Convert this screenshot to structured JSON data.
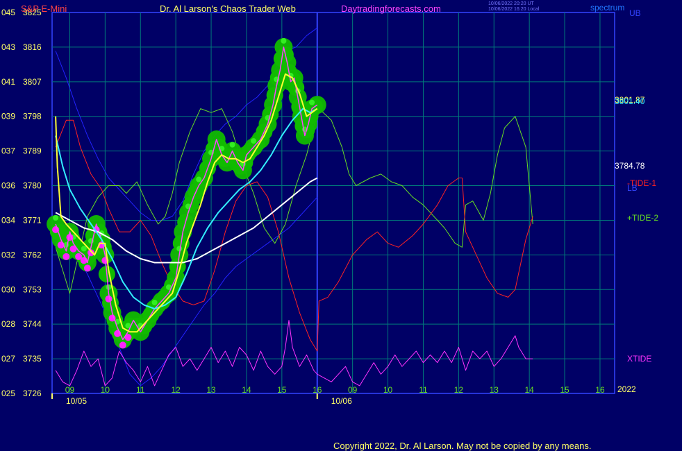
{
  "header": {
    "symbol": "S&P E-Mini",
    "title": "Dr. Al Larson's Chaos Trader Web",
    "site": "Daytradingforecasts.com",
    "stamp_line1": "10/06/2022 20:20 UT",
    "stamp_line2": "10/06/2022 16:20 Local",
    "spectrum": "spectrum",
    "ub": "UB"
  },
  "footer": {
    "copyright": "Copyright 2022, Dr. Al Larson. May not be copied by any means."
  },
  "colors": {
    "background": "#000066",
    "grid": "#007a7a",
    "price_bar": "#ff44ff",
    "band_glow": "#11bb00",
    "band_dot": "#33ee22",
    "magenta_dot": "#ff22ff",
    "ema_fast": "#ffff33",
    "ema_mid": "#33eeff",
    "ema_slow": "#ffffff",
    "bands": "#2222ff",
    "tide1": "#ff2222",
    "tide2": "#66dd22",
    "xtide": "#ff33ff",
    "axis_text": "#ffff66",
    "header_red": "#ff4444",
    "header_site": "#ff44ff"
  },
  "chart_data": {
    "type": "line",
    "title": "S&P E-Mini",
    "y_left_labels": [
      "045",
      "043",
      "041",
      "039",
      "037",
      "036",
      "034",
      "032",
      "030",
      "028",
      "027",
      "025"
    ],
    "y_right_labels": [
      "3825",
      "3816",
      "3807",
      "3798",
      "3789",
      "3780",
      "3771",
      "3762",
      "3753",
      "3744",
      "3735",
      "3726"
    ],
    "ylim": [
      3726,
      3825
    ],
    "x_hour_labels": [
      "09",
      "10",
      "11",
      "12",
      "13",
      "14",
      "15",
      "16",
      "09",
      "10",
      "11",
      "12",
      "13",
      "14",
      "15",
      "16"
    ],
    "x_date_labels": [
      "10/05",
      "10/06"
    ],
    "x_year": "2022",
    "right_value_labels": [
      "3801.87",
      "3801.40",
      "3784.78"
    ],
    "series_labels": {
      "tide1": "-TIDE-1",
      "tide2": "+TIDE-2",
      "xtide": "XTIDE",
      "lb": "LB"
    },
    "price": [
      [
        8.6,
        3770
      ],
      [
        8.75,
        3766
      ],
      [
        8.9,
        3763
      ],
      [
        9.0,
        3768
      ],
      [
        9.1,
        3765
      ],
      [
        9.25,
        3763
      ],
      [
        9.4,
        3762
      ],
      [
        9.5,
        3760
      ],
      [
        9.6,
        3764
      ],
      [
        9.75,
        3770
      ],
      [
        9.9,
        3766
      ],
      [
        10.0,
        3762
      ],
      [
        10.1,
        3752
      ],
      [
        10.2,
        3747
      ],
      [
        10.35,
        3743
      ],
      [
        10.5,
        3740
      ],
      [
        10.65,
        3742
      ],
      [
        10.8,
        3745
      ],
      [
        11.0,
        3742
      ],
      [
        11.2,
        3745
      ],
      [
        11.4,
        3748
      ],
      [
        11.6,
        3750
      ],
      [
        11.8,
        3752
      ],
      [
        12.0,
        3756
      ],
      [
        12.1,
        3762
      ],
      [
        12.2,
        3768
      ],
      [
        12.35,
        3773
      ],
      [
        12.5,
        3777
      ],
      [
        12.65,
        3780
      ],
      [
        12.8,
        3782
      ],
      [
        13.0,
        3787
      ],
      [
        13.15,
        3792
      ],
      [
        13.3,
        3788
      ],
      [
        13.45,
        3786
      ],
      [
        13.6,
        3789
      ],
      [
        13.75,
        3786
      ],
      [
        13.9,
        3784
      ],
      [
        14.0,
        3788
      ],
      [
        14.2,
        3790
      ],
      [
        14.4,
        3792
      ],
      [
        14.6,
        3796
      ],
      [
        14.75,
        3801
      ],
      [
        14.85,
        3806
      ],
      [
        14.95,
        3810
      ],
      [
        15.05,
        3816
      ],
      [
        15.15,
        3812
      ],
      [
        15.25,
        3807
      ],
      [
        15.35,
        3808
      ],
      [
        15.45,
        3803
      ],
      [
        15.55,
        3798
      ],
      [
        15.65,
        3793
      ],
      [
        15.75,
        3796
      ],
      [
        15.85,
        3800
      ],
      [
        16.0,
        3801
      ]
    ],
    "ema_fast": [
      [
        8.6,
        3798
      ],
      [
        8.65,
        3785
      ],
      [
        8.75,
        3772
      ],
      [
        8.9,
        3770
      ],
      [
        9.1,
        3768
      ],
      [
        9.3,
        3766
      ],
      [
        9.5,
        3764
      ],
      [
        9.7,
        3762
      ],
      [
        9.85,
        3765
      ],
      [
        10.0,
        3765
      ],
      [
        10.1,
        3758
      ],
      [
        10.3,
        3749
      ],
      [
        10.5,
        3743
      ],
      [
        10.7,
        3742
      ],
      [
        10.9,
        3742
      ],
      [
        11.1,
        3744
      ],
      [
        11.3,
        3746
      ],
      [
        11.5,
        3748
      ],
      [
        11.7,
        3750
      ],
      [
        11.9,
        3752
      ],
      [
        12.1,
        3758
      ],
      [
        12.3,
        3765
      ],
      [
        12.5,
        3770
      ],
      [
        12.7,
        3775
      ],
      [
        12.9,
        3781
      ],
      [
        13.1,
        3786
      ],
      [
        13.3,
        3788
      ],
      [
        13.5,
        3787
      ],
      [
        13.7,
        3787
      ],
      [
        13.9,
        3786
      ],
      [
        14.1,
        3787
      ],
      [
        14.3,
        3790
      ],
      [
        14.5,
        3793
      ],
      [
        14.7,
        3797
      ],
      [
        14.9,
        3803
      ],
      [
        15.1,
        3809
      ],
      [
        15.3,
        3808
      ],
      [
        15.5,
        3804
      ],
      [
        15.7,
        3798
      ],
      [
        15.85,
        3799
      ],
      [
        16.0,
        3800
      ]
    ],
    "ema_mid": [
      [
        8.6,
        3793
      ],
      [
        8.8,
        3785
      ],
      [
        9.0,
        3779
      ],
      [
        9.3,
        3774
      ],
      [
        9.6,
        3770
      ],
      [
        9.9,
        3766
      ],
      [
        10.2,
        3761
      ],
      [
        10.5,
        3755
      ],
      [
        10.8,
        3751
      ],
      [
        11.1,
        3749
      ],
      [
        11.4,
        3748
      ],
      [
        11.7,
        3749
      ],
      [
        12.0,
        3751
      ],
      [
        12.3,
        3757
      ],
      [
        12.6,
        3764
      ],
      [
        12.9,
        3769
      ],
      [
        13.2,
        3773
      ],
      [
        13.5,
        3776
      ],
      [
        13.8,
        3779
      ],
      [
        14.1,
        3781
      ],
      [
        14.4,
        3784
      ],
      [
        14.7,
        3788
      ],
      [
        15.0,
        3793
      ],
      [
        15.3,
        3797
      ],
      [
        15.6,
        3800
      ],
      [
        15.8,
        3799
      ],
      [
        16.0,
        3800
      ]
    ],
    "ema_slow": [
      [
        8.6,
        3773
      ],
      [
        9.0,
        3771
      ],
      [
        9.4,
        3769
      ],
      [
        9.8,
        3768
      ],
      [
        10.2,
        3766
      ],
      [
        10.6,
        3763
      ],
      [
        11.0,
        3761
      ],
      [
        11.4,
        3760
      ],
      [
        11.8,
        3760
      ],
      [
        12.2,
        3760
      ],
      [
        12.6,
        3761
      ],
      [
        13.0,
        3763
      ],
      [
        13.4,
        3765
      ],
      [
        13.8,
        3767
      ],
      [
        14.2,
        3769
      ],
      [
        14.6,
        3772
      ],
      [
        15.0,
        3775
      ],
      [
        15.4,
        3778
      ],
      [
        15.8,
        3781
      ],
      [
        16.0,
        3782
      ]
    ],
    "band_upper": [
      [
        8.6,
        3815
      ],
      [
        8.9,
        3808
      ],
      [
        9.2,
        3800
      ],
      [
        9.5,
        3793
      ],
      [
        9.8,
        3787
      ],
      [
        10.1,
        3782
      ],
      [
        10.4,
        3779
      ],
      [
        10.7,
        3776
      ],
      [
        11.0,
        3773
      ],
      [
        11.3,
        3771
      ],
      [
        11.6,
        3771
      ],
      [
        11.9,
        3772
      ],
      [
        12.2,
        3776
      ],
      [
        12.5,
        3783
      ],
      [
        12.8,
        3789
      ],
      [
        13.1,
        3793
      ],
      [
        13.4,
        3796
      ],
      [
        13.7,
        3798
      ],
      [
        14.0,
        3801
      ],
      [
        14.3,
        3803
      ],
      [
        14.6,
        3806
      ],
      [
        14.9,
        3812
      ],
      [
        15.1,
        3815
      ],
      [
        15.4,
        3816
      ],
      [
        15.7,
        3819
      ],
      [
        16.0,
        3821
      ]
    ],
    "band_lower": [
      [
        8.6,
        3769
      ],
      [
        8.9,
        3767
      ],
      [
        9.2,
        3762
      ],
      [
        9.5,
        3757
      ],
      [
        9.8,
        3751
      ],
      [
        10.1,
        3745
      ],
      [
        10.4,
        3738
      ],
      [
        10.7,
        3731
      ],
      [
        11.0,
        3728
      ],
      [
        11.3,
        3730
      ],
      [
        11.6,
        3733
      ],
      [
        11.9,
        3737
      ],
      [
        12.2,
        3741
      ],
      [
        12.5,
        3745
      ],
      [
        12.8,
        3749
      ],
      [
        13.1,
        3752
      ],
      [
        13.4,
        3756
      ],
      [
        13.7,
        3759
      ],
      [
        14.0,
        3761
      ],
      [
        14.3,
        3763
      ],
      [
        14.6,
        3765
      ],
      [
        14.9,
        3767
      ],
      [
        15.2,
        3769
      ],
      [
        15.5,
        3772
      ],
      [
        15.8,
        3775
      ],
      [
        16.0,
        3777
      ]
    ],
    "tide1": [
      [
        8.6,
        3790
      ],
      [
        8.9,
        3797
      ],
      [
        9.1,
        3797
      ],
      [
        9.3,
        3790
      ],
      [
        9.6,
        3783
      ],
      [
        9.9,
        3779
      ],
      [
        10.1,
        3774
      ],
      [
        10.4,
        3768
      ],
      [
        10.7,
        3768
      ],
      [
        11.0,
        3771
      ],
      [
        11.3,
        3767
      ],
      [
        11.6,
        3760
      ],
      [
        11.9,
        3754
      ],
      [
        12.2,
        3750
      ],
      [
        12.5,
        3749
      ],
      [
        12.8,
        3750
      ],
      [
        13.1,
        3758
      ],
      [
        13.4,
        3768
      ],
      [
        13.7,
        3776
      ],
      [
        14.0,
        3780
      ],
      [
        14.3,
        3781
      ],
      [
        14.6,
        3777
      ],
      [
        14.9,
        3768
      ],
      [
        15.2,
        3756
      ],
      [
        15.5,
        3747
      ],
      [
        15.8,
        3740
      ],
      [
        16.0,
        3737
      ],
      [
        16.05,
        3750
      ],
      [
        16.3,
        3751
      ],
      [
        16.6,
        3755
      ],
      [
        17.0,
        3762
      ],
      [
        17.4,
        3766
      ],
      [
        17.7,
        3768
      ],
      [
        18.0,
        3765
      ],
      [
        18.3,
        3764
      ],
      [
        18.7,
        3767
      ],
      [
        19.0,
        3770
      ],
      [
        19.4,
        3775
      ],
      [
        19.7,
        3780
      ],
      [
        20.0,
        3782
      ],
      [
        20.1,
        3782
      ],
      [
        20.2,
        3768
      ],
      [
        20.5,
        3762
      ],
      [
        20.8,
        3756
      ],
      [
        21.1,
        3752
      ],
      [
        21.4,
        3751
      ],
      [
        21.6,
        3753
      ],
      [
        21.9,
        3766
      ],
      [
        22.1,
        3772
      ]
    ],
    "tide2": [
      [
        8.6,
        3764
      ],
      [
        8.8,
        3758
      ],
      [
        9.0,
        3752
      ],
      [
        9.2,
        3760
      ],
      [
        9.5,
        3772
      ],
      [
        9.8,
        3777
      ],
      [
        10.1,
        3780
      ],
      [
        10.4,
        3780
      ],
      [
        10.6,
        3778
      ],
      [
        10.9,
        3781
      ],
      [
        11.2,
        3775
      ],
      [
        11.5,
        3770
      ],
      [
        11.7,
        3772
      ],
      [
        11.9,
        3778
      ],
      [
        12.1,
        3786
      ],
      [
        12.4,
        3794
      ],
      [
        12.7,
        3800
      ],
      [
        13.0,
        3799
      ],
      [
        13.3,
        3800
      ],
      [
        13.6,
        3794
      ],
      [
        13.9,
        3785
      ],
      [
        14.2,
        3778
      ],
      [
        14.5,
        3769
      ],
      [
        14.8,
        3765
      ],
      [
        15.1,
        3770
      ],
      [
        15.4,
        3780
      ],
      [
        15.7,
        3788
      ],
      [
        16.0,
        3799
      ],
      [
        16.05,
        3800
      ],
      [
        16.4,
        3797
      ],
      [
        16.7,
        3790
      ],
      [
        16.9,
        3783
      ],
      [
        17.1,
        3780
      ],
      [
        17.5,
        3782
      ],
      [
        17.8,
        3783
      ],
      [
        18.1,
        3781
      ],
      [
        18.4,
        3780
      ],
      [
        18.7,
        3777
      ],
      [
        19.0,
        3775
      ],
      [
        19.3,
        3772
      ],
      [
        19.6,
        3769
      ],
      [
        19.9,
        3765
      ],
      [
        20.1,
        3764
      ],
      [
        20.2,
        3775
      ],
      [
        20.4,
        3776
      ],
      [
        20.7,
        3771
      ],
      [
        20.9,
        3778
      ],
      [
        21.1,
        3788
      ],
      [
        21.3,
        3795
      ],
      [
        21.6,
        3798
      ],
      [
        21.9,
        3790
      ],
      [
        22.1,
        3770
      ]
    ],
    "xtide": [
      [
        8.6,
        3732
      ],
      [
        8.8,
        3729
      ],
      [
        9.0,
        3728
      ],
      [
        9.2,
        3732
      ],
      [
        9.4,
        3737
      ],
      [
        9.6,
        3733
      ],
      [
        9.8,
        3735
      ],
      [
        10.0,
        3728
      ],
      [
        10.2,
        3730
      ],
      [
        10.4,
        3737
      ],
      [
        10.6,
        3734
      ],
      [
        10.8,
        3732
      ],
      [
        11.0,
        3729
      ],
      [
        11.2,
        3733
      ],
      [
        11.4,
        3728
      ],
      [
        11.6,
        3732
      ],
      [
        11.8,
        3736
      ],
      [
        12.0,
        3738
      ],
      [
        12.2,
        3733
      ],
      [
        12.4,
        3735
      ],
      [
        12.6,
        3732
      ],
      [
        12.8,
        3735
      ],
      [
        13.0,
        3738
      ],
      [
        13.2,
        3734
      ],
      [
        13.4,
        3737
      ],
      [
        13.6,
        3733
      ],
      [
        13.8,
        3738
      ],
      [
        14.0,
        3736
      ],
      [
        14.2,
        3732
      ],
      [
        14.4,
        3737
      ],
      [
        14.6,
        3733
      ],
      [
        14.8,
        3731
      ],
      [
        15.0,
        3733
      ],
      [
        15.1,
        3738
      ],
      [
        15.2,
        3745
      ],
      [
        15.3,
        3738
      ],
      [
        15.5,
        3733
      ],
      [
        15.7,
        3736
      ],
      [
        15.9,
        3732
      ],
      [
        16.0,
        3731
      ],
      [
        16.2,
        3730
      ],
      [
        16.4,
        3729
      ],
      [
        16.6,
        3731
      ],
      [
        16.8,
        3733
      ],
      [
        17.0,
        3729
      ],
      [
        17.2,
        3728
      ],
      [
        17.4,
        3731
      ],
      [
        17.6,
        3734
      ],
      [
        17.8,
        3731
      ],
      [
        18.0,
        3733
      ],
      [
        18.2,
        3736
      ],
      [
        18.4,
        3733
      ],
      [
        18.6,
        3735
      ],
      [
        18.8,
        3737
      ],
      [
        19.0,
        3734
      ],
      [
        19.2,
        3736
      ],
      [
        19.4,
        3734
      ],
      [
        19.6,
        3737
      ],
      [
        19.8,
        3734
      ],
      [
        20.0,
        3738
      ],
      [
        20.2,
        3732
      ],
      [
        20.4,
        3737
      ],
      [
        20.6,
        3735
      ],
      [
        20.8,
        3737
      ],
      [
        21.0,
        3733
      ],
      [
        21.2,
        3735
      ],
      [
        21.4,
        3738
      ],
      [
        21.6,
        3741
      ],
      [
        21.7,
        3738
      ],
      [
        21.9,
        3735
      ],
      [
        22.1,
        3735
      ]
    ]
  }
}
